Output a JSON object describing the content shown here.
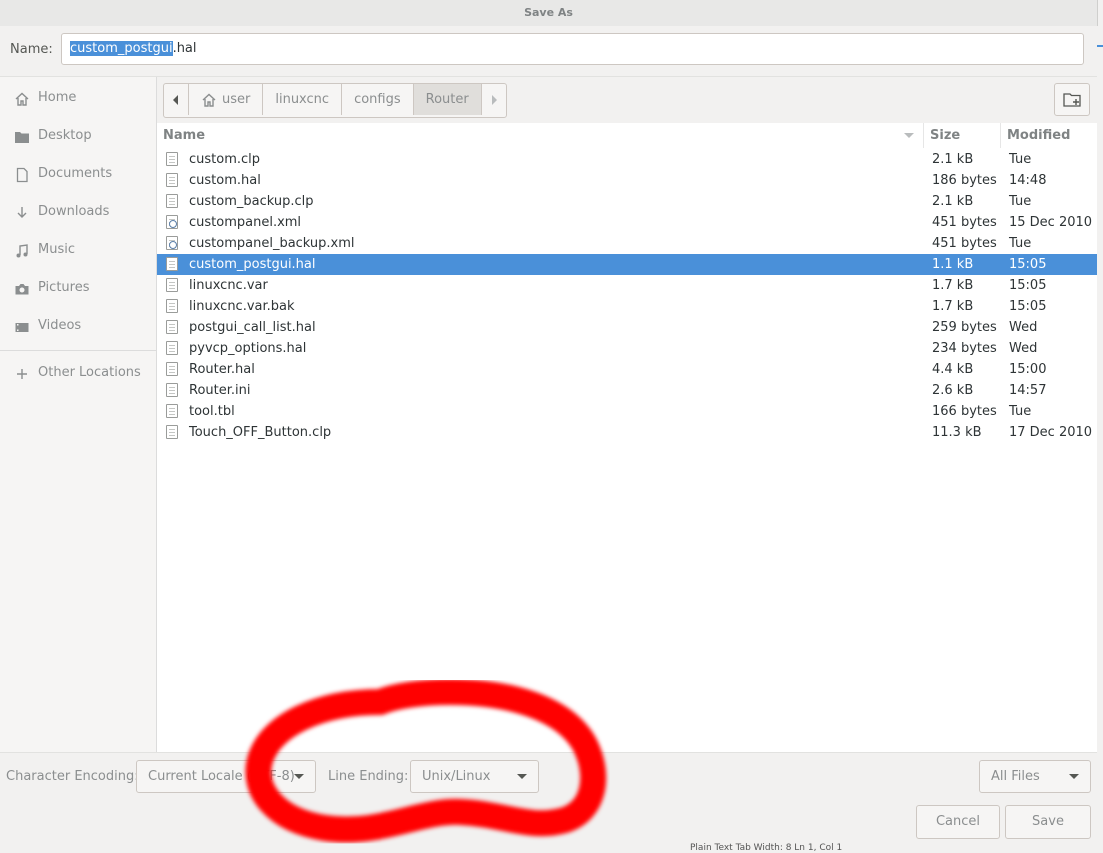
{
  "window": {
    "title": "Save As"
  },
  "name_field": {
    "label": "Name:",
    "value_selected": "custom_postgui",
    "value_rest": ".hal"
  },
  "sidebar": {
    "items": [
      {
        "label": "Home",
        "icon": "home-icon"
      },
      {
        "label": "Desktop",
        "icon": "desktop-folder-icon"
      },
      {
        "label": "Documents",
        "icon": "document-icon"
      },
      {
        "label": "Downloads",
        "icon": "download-icon"
      },
      {
        "label": "Music",
        "icon": "music-icon"
      },
      {
        "label": "Pictures",
        "icon": "camera-icon"
      },
      {
        "label": "Videos",
        "icon": "video-icon"
      }
    ],
    "other_locations": {
      "label": "Other Locations",
      "icon": "plus-icon"
    }
  },
  "pathbar": {
    "crumbs": [
      "user",
      "linuxcnc",
      "configs",
      "Router"
    ],
    "active": "Router"
  },
  "file_list": {
    "columns": {
      "name": "Name",
      "size": "Size",
      "modified": "Modified"
    },
    "rows": [
      {
        "name": "custom.clp",
        "size": "2.1 kB",
        "modified": "Tue",
        "type": "text"
      },
      {
        "name": "custom.hal",
        "size": "186 bytes",
        "modified": "14:48",
        "type": "text"
      },
      {
        "name": "custom_backup.clp",
        "size": "2.1 kB",
        "modified": "Tue",
        "type": "text"
      },
      {
        "name": "custompanel.xml",
        "size": "451 bytes",
        "modified": "15 Dec 2010",
        "type": "xml"
      },
      {
        "name": "custompanel_backup.xml",
        "size": "451 bytes",
        "modified": "Tue",
        "type": "xml"
      },
      {
        "name": "custom_postgui.hal",
        "size": "1.1 kB",
        "modified": "15:05",
        "type": "text",
        "selected": true
      },
      {
        "name": "linuxcnc.var",
        "size": "1.7 kB",
        "modified": "15:05",
        "type": "text"
      },
      {
        "name": "linuxcnc.var.bak",
        "size": "1.7 kB",
        "modified": "15:05",
        "type": "text"
      },
      {
        "name": "postgui_call_list.hal",
        "size": "259 bytes",
        "modified": "Wed",
        "type": "text"
      },
      {
        "name": "pyvcp_options.hal",
        "size": "234 bytes",
        "modified": "Wed",
        "type": "text"
      },
      {
        "name": "Router.hal",
        "size": "4.4 kB",
        "modified": "15:00",
        "type": "text"
      },
      {
        "name": "Router.ini",
        "size": "2.6 kB",
        "modified": "14:57",
        "type": "text"
      },
      {
        "name": "tool.tbl",
        "size": "166 bytes",
        "modified": "Tue",
        "type": "text"
      },
      {
        "name": "Touch_OFF_Button.clp",
        "size": "11.3 kB",
        "modified": "17 Dec 2010",
        "type": "text"
      }
    ]
  },
  "bottom": {
    "encoding_label": "Character Encoding:",
    "encoding_value": "Current Locale (UTF-8)",
    "line_ending_label": "Line Ending:",
    "line_ending_value": "Unix/Linux",
    "filter_value": "All Files",
    "cancel_label": "Cancel",
    "save_label": "Save"
  },
  "background_status": "Plain Text   Tab Width: 8   Ln 1, Col 1",
  "colors": {
    "selection": "#4a90d9",
    "annotation": "#ff0000"
  }
}
